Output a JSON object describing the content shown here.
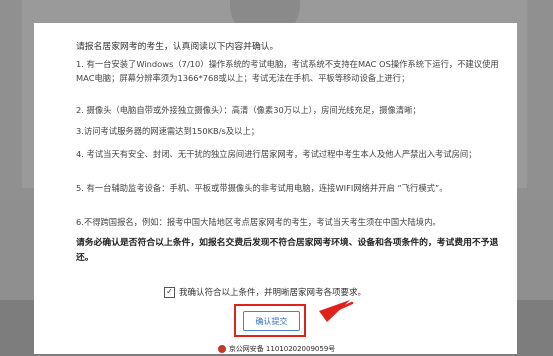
{
  "modal": {
    "intro": "请报名居家网考的考生，认真阅读以下内容并确认。",
    "items": [
      "1. 有一台安装了Windows（7/10）操作系统的考试电脑，考试系统不支持在MAC OS操作系统下运行，不建议使用MAC电脑；屏幕分辨率须为1366*768或以上；考试无法在手机、平板等移动设备上进行；",
      "2. 摄像头（电脑自带或外接独立摄像头）：高清（像素30万以上），房间光线充足，摄像清晰；",
      "3.访问考试服务器的网速需达到150KB/s及以上；",
      "4. 考试当天有安全、封闭、无干扰的独立房间进行居家网考，考试过程中考生本人及他人严禁出入考试房间；",
      "5. 有一台辅助监考设备：手机、平板或带摄像头的非考试用电脑，连接WIFI网络并开启 “飞行模式”。",
      "6.不得跨国报名，例如：报考中国大陆地区考点居家网考的考生，考试当天考生须在中国大陆境内。"
    ],
    "warning": "请务必确认是否符合以上条件，如报名交费后发现不符合居家网考环境、设备和各项条件的，考试费用不予退还。",
    "agree_label": "我确认符合以上条件，并明晰居家网考各项要求。",
    "agree_checked": true,
    "submit_label": "确认提交"
  },
  "footer": {
    "text": "京公网安备 11010202009059号"
  },
  "annotation_color": "#e0211c"
}
